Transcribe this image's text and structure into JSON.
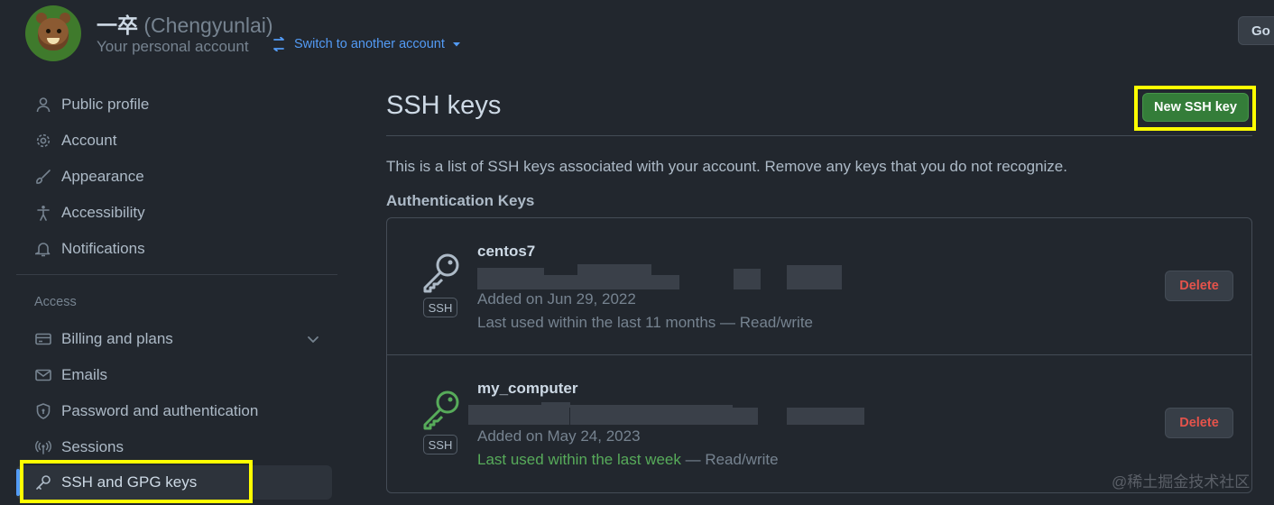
{
  "header": {
    "display_name": "一卒",
    "login": "(Chengyunlai)",
    "subtitle": "Your personal account",
    "switch_label": "Switch to another account",
    "go_label": "Go"
  },
  "sidebar": {
    "items": [
      {
        "label": "Public profile",
        "icon": "person-icon"
      },
      {
        "label": "Account",
        "icon": "gear-icon"
      },
      {
        "label": "Appearance",
        "icon": "paintbrush-icon"
      },
      {
        "label": "Accessibility",
        "icon": "accessibility-icon"
      },
      {
        "label": "Notifications",
        "icon": "bell-icon"
      }
    ],
    "access_heading": "Access",
    "access_items": [
      {
        "label": "Billing and plans",
        "icon": "credit-card-icon"
      },
      {
        "label": "Emails",
        "icon": "mail-icon"
      },
      {
        "label": "Password and authentication",
        "icon": "shield-lock-icon"
      },
      {
        "label": "Sessions",
        "icon": "broadcast-icon"
      },
      {
        "label": "SSH and GPG keys",
        "icon": "key-icon"
      }
    ]
  },
  "main": {
    "title": "SSH keys",
    "new_button": "New SSH key",
    "intro": "This is a list of SSH keys associated with your account. Remove any keys that you do not recognize.",
    "section_heading": "Authentication Keys",
    "keys": [
      {
        "title": "centos7",
        "badge": "SSH",
        "added": "Added on Jun 29, 2022",
        "last_used": "Last used within the last 11 months",
        "access": "— Read/write",
        "delete_label": "Delete",
        "icon_color": "#adbac7"
      },
      {
        "title": "my_computer",
        "badge": "SSH",
        "added": "Added on May 24, 2023",
        "last_used": "Last used within the last week",
        "access": "— Read/write",
        "delete_label": "Delete",
        "icon_color": "#57ab5a"
      }
    ]
  },
  "watermark": "@稀土掘金技术社区",
  "colors": {
    "background": "#22272e",
    "primary_button": "#347d39",
    "danger_text": "#e5534b",
    "link": "#539bf5",
    "highlight": "#ffff00"
  }
}
